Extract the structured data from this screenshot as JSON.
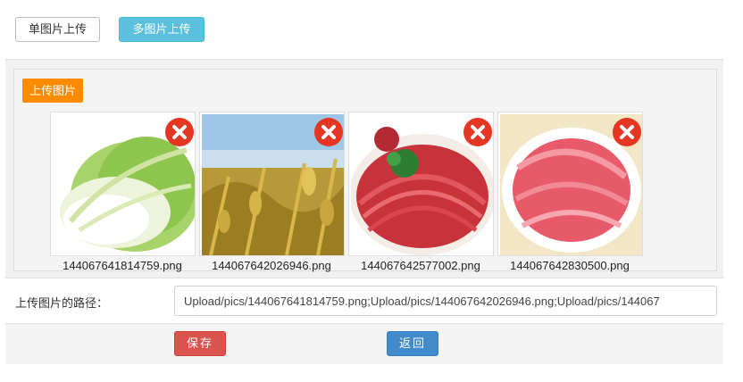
{
  "top_buttons": {
    "single_label": "单图片上传",
    "multi_label": "多图片上传"
  },
  "upload_panel": {
    "legend": "上传图片",
    "images": [
      {
        "filename": "144067641814759.png",
        "subject": "napa cabbage"
      },
      {
        "filename": "144067642026946.png",
        "subject": "soybean plants"
      },
      {
        "filename": "144067642577002.png",
        "subject": "sliced beef platter"
      },
      {
        "filename": "144067642830500.png",
        "subject": "sliced lamb plate"
      }
    ],
    "delete_icon": "close-icon"
  },
  "path_row": {
    "label": "上传图片的路径：",
    "value": "Upload/pics/144067641814759.png;Upload/pics/144067642026946.png;Upload/pics/144067"
  },
  "actions": {
    "save_label": "保存",
    "back_label": "返回"
  },
  "colors": {
    "multi_button": "#5bc0de",
    "legend_orange": "#ff8c00",
    "delete_red": "#e53523",
    "save_red": "#d9534f",
    "back_blue": "#428bca"
  }
}
